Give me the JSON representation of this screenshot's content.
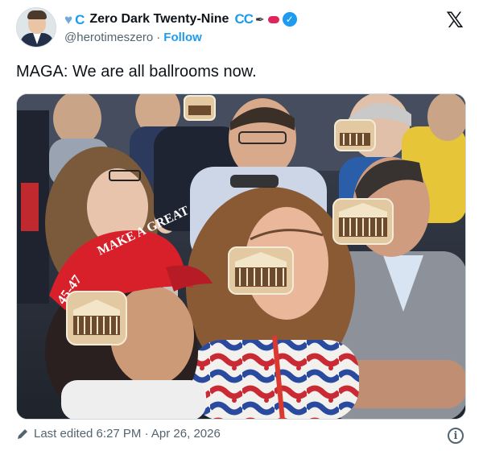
{
  "post": {
    "author": {
      "display_name": "Zero Dark Twenty-Nine",
      "handle": "@herotimeszero",
      "separator": "·",
      "follow_label": "Follow",
      "name_emojis": [
        "blue-heart",
        "c-letter",
        "cc-letters",
        "pen",
        "lips"
      ],
      "verified": true
    },
    "text": "MAGA: We are all ballrooms now.",
    "image": {
      "hat_front_text": "MAKE A GREAT",
      "hat_side_text": "45-47"
    },
    "footer": {
      "edited_label": "Last edited 6:27 PM · Apr 26, 2026"
    },
    "platform_icon": "x-logo"
  },
  "colors": {
    "accent": "#1d9bf0",
    "text_primary": "#0f1419",
    "text_secondary": "#536471",
    "hat_red": "#d8202b"
  }
}
